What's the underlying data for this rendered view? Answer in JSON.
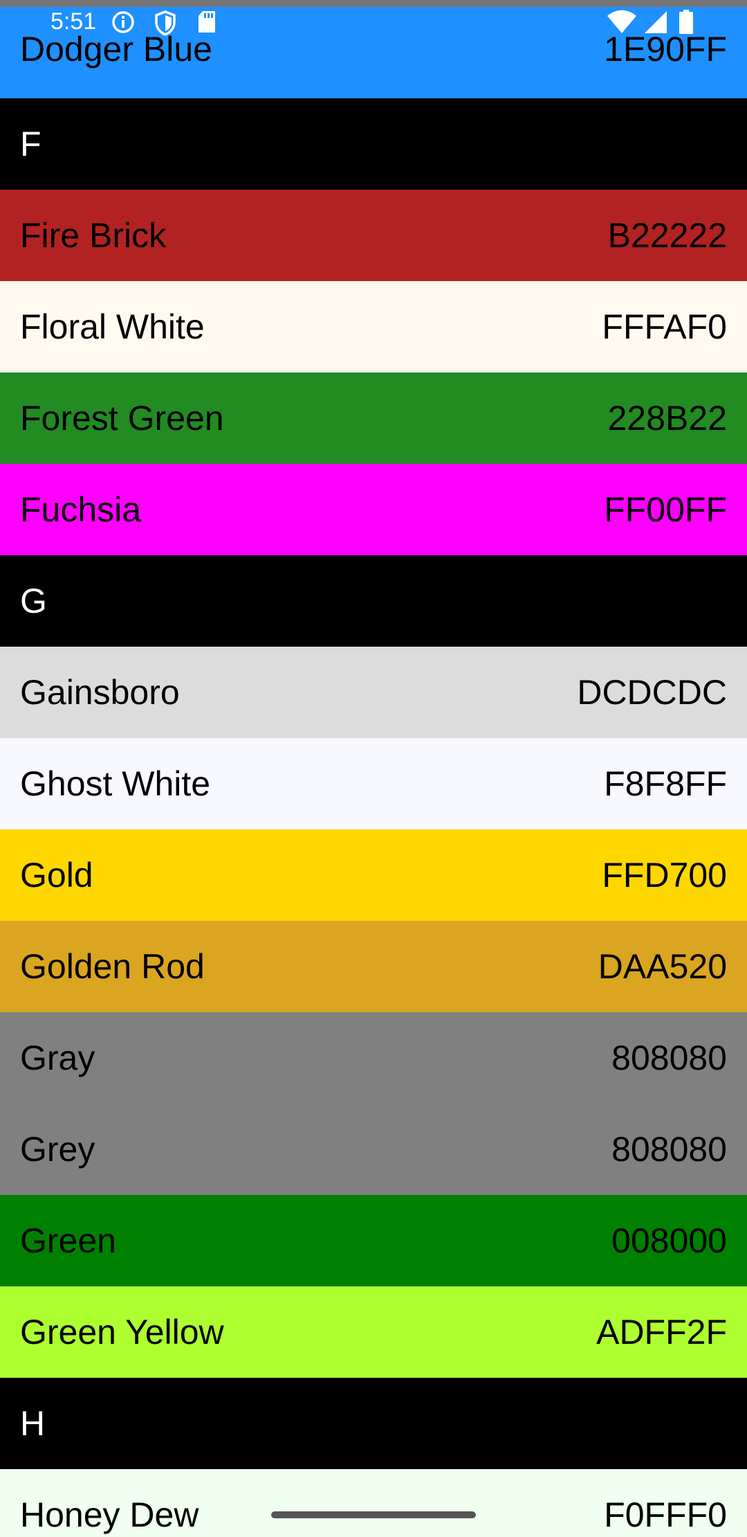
{
  "status_bar": {
    "time": "5:51"
  },
  "rows": [
    {
      "type": "color",
      "name": "Dodger Blue",
      "hex": "1E90FF",
      "bg": "#1E90FF"
    },
    {
      "type": "header",
      "letter": "F"
    },
    {
      "type": "color",
      "name": "Fire Brick",
      "hex": "B22222",
      "bg": "#B22222"
    },
    {
      "type": "color",
      "name": "Floral White",
      "hex": "FFFAF0",
      "bg": "#FFFAF0"
    },
    {
      "type": "color",
      "name": "Forest Green",
      "hex": "228B22",
      "bg": "#228B22"
    },
    {
      "type": "color",
      "name": "Fuchsia",
      "hex": "FF00FF",
      "bg": "#FF00FF"
    },
    {
      "type": "header",
      "letter": "G"
    },
    {
      "type": "color",
      "name": "Gainsboro",
      "hex": "DCDCDC",
      "bg": "#DCDCDC"
    },
    {
      "type": "color",
      "name": "Ghost White",
      "hex": "F8F8FF",
      "bg": "#F8F8FF"
    },
    {
      "type": "color",
      "name": "Gold",
      "hex": "FFD700",
      "bg": "#FFD700"
    },
    {
      "type": "color",
      "name": "Golden Rod",
      "hex": "DAA520",
      "bg": "#DAA520"
    },
    {
      "type": "color",
      "name": "Gray",
      "hex": "808080",
      "bg": "#808080"
    },
    {
      "type": "color",
      "name": "Grey",
      "hex": "808080",
      "bg": "#808080"
    },
    {
      "type": "color",
      "name": "Green",
      "hex": "008000",
      "bg": "#008000"
    },
    {
      "type": "color",
      "name": "Green Yellow",
      "hex": "ADFF2F",
      "bg": "#ADFF2F"
    },
    {
      "type": "header",
      "letter": "H"
    },
    {
      "type": "color",
      "name": "Honey Dew",
      "hex": "F0FFF0",
      "bg": "#F0FFF0"
    }
  ],
  "colors": {
    "header_bg": "#000000",
    "header_text": "#FFFFFF",
    "row_text": "#000000"
  },
  "icons": [
    "info-icon",
    "shield-icon",
    "sd-card-icon",
    "wifi-icon",
    "signal-icon",
    "battery-icon"
  ]
}
